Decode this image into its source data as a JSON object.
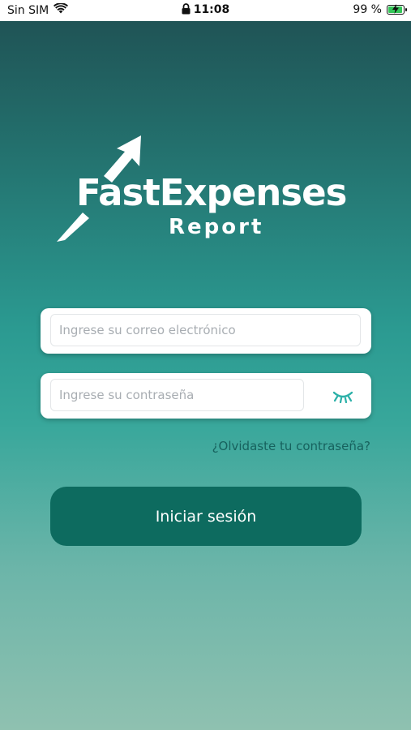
{
  "status_bar": {
    "carrier": "Sin SIM",
    "time": "11:08",
    "battery": "99 %",
    "battery_level": 0.99,
    "icons": [
      "wifi-icon",
      "lock-icon",
      "battery-charging-icon"
    ]
  },
  "logo": {
    "title": "FastExpenses",
    "subtitle": "Report",
    "icon": "arrow-up-right-icon"
  },
  "form": {
    "email_placeholder": "Ingrese su correo electrónico",
    "email_value": "",
    "password_placeholder": "Ingrese su contraseña",
    "password_value": "",
    "password_toggle_icon": "eye-closed-icon",
    "forgot_link": "¿Olvidaste tu contraseña?",
    "login_button": "Iniciar sesión"
  },
  "colors": {
    "primary": "#0d6b5f",
    "link": "#17625e",
    "accent_icon": "#2bb0a8"
  }
}
